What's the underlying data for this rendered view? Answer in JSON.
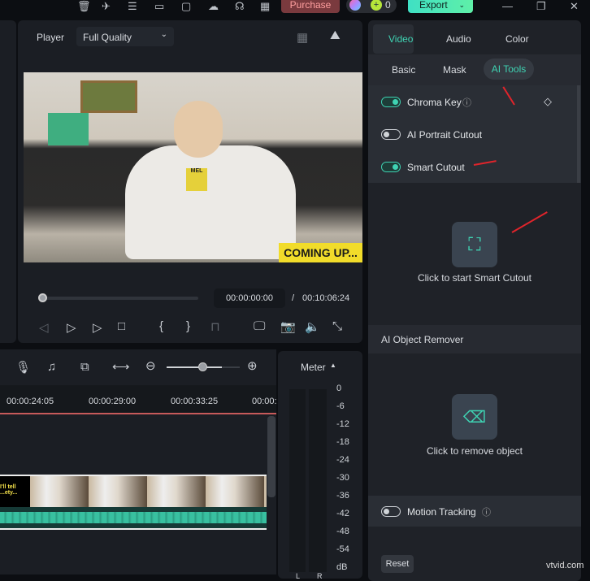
{
  "topbar": {
    "purchase": "Purchase",
    "credits": "0",
    "export": "Export"
  },
  "player": {
    "label": "Player",
    "quality": "Full Quality",
    "current_time": "00:00:00:00",
    "separator": "/",
    "total_time": "00:10:06:24",
    "video_caption": "COMING UP...",
    "mic_badge": "MEL"
  },
  "timeline": {
    "ruler": [
      "00:00:24:05",
      "00:00:29:00",
      "00:00:33:25",
      "00:00:"
    ],
    "zoom_level": 0.75,
    "clip_caption": "I'll tell ...ety..."
  },
  "meter": {
    "title": "Meter",
    "scale": [
      "0",
      "-6",
      "-12",
      "-18",
      "-24",
      "-30",
      "-36",
      "-42",
      "-48",
      "-54",
      "dB"
    ],
    "channels": [
      "L",
      "R"
    ]
  },
  "inspector": {
    "tabs": [
      "Video",
      "Audio",
      "Color"
    ],
    "subtabs": [
      "Basic",
      "Mask",
      "AI Tools"
    ],
    "chroma_key": "Chroma Key",
    "ai_portrait": "AI Portrait Cutout",
    "smart_cutout": "Smart Cutout",
    "smart_cutout_cta": "Click to start Smart Cutout",
    "object_remover_title": "AI Object Remover",
    "object_remover_cta": "Click to remove object",
    "motion_tracking": "Motion Tracking",
    "reset": "Reset"
  },
  "watermark": "vtvid.com",
  "colors": {
    "accent": "#3fd3b3",
    "annotation": "#e0242b"
  }
}
